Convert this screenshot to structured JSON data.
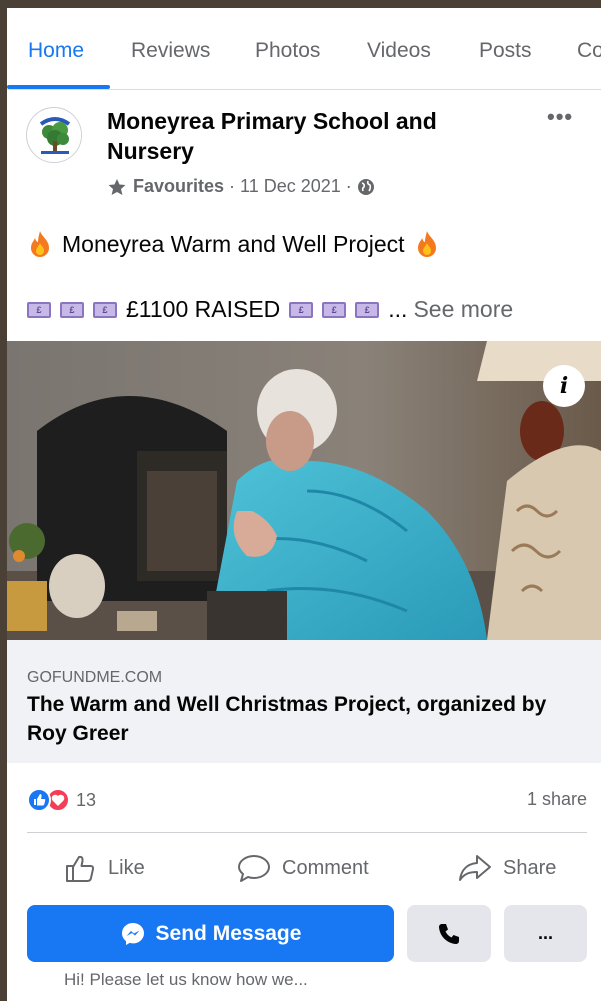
{
  "tabs": [
    {
      "label": "Home"
    },
    {
      "label": "Reviews"
    },
    {
      "label": "Photos"
    },
    {
      "label": "Videos"
    },
    {
      "label": "Posts"
    },
    {
      "label": "Co"
    }
  ],
  "post": {
    "page_name": "Moneyrea Primary School and Nursery",
    "favourites_label": "Favourites",
    "date": "11 Dec 2021",
    "line1": "Moneyrea Warm and Well Project",
    "line2": "£1100 RAISED",
    "see_more": "See more",
    "ellipsis": "..."
  },
  "link": {
    "domain": "GOFUNDME.COM",
    "title": "The Warm and Well Christmas Project, organized by Roy Greer"
  },
  "engagement": {
    "reaction_count": "13",
    "shares": "1 share"
  },
  "actions": {
    "like": "Like",
    "comment": "Comment",
    "share": "Share"
  },
  "messenger": {
    "send_label": "Send Message",
    "more_label": "...",
    "greeting": "Hi! Please let us know how we..."
  },
  "colors": {
    "accent": "#1877f2",
    "secondary_text": "#65676b",
    "button_grey": "#e4e6eb"
  }
}
